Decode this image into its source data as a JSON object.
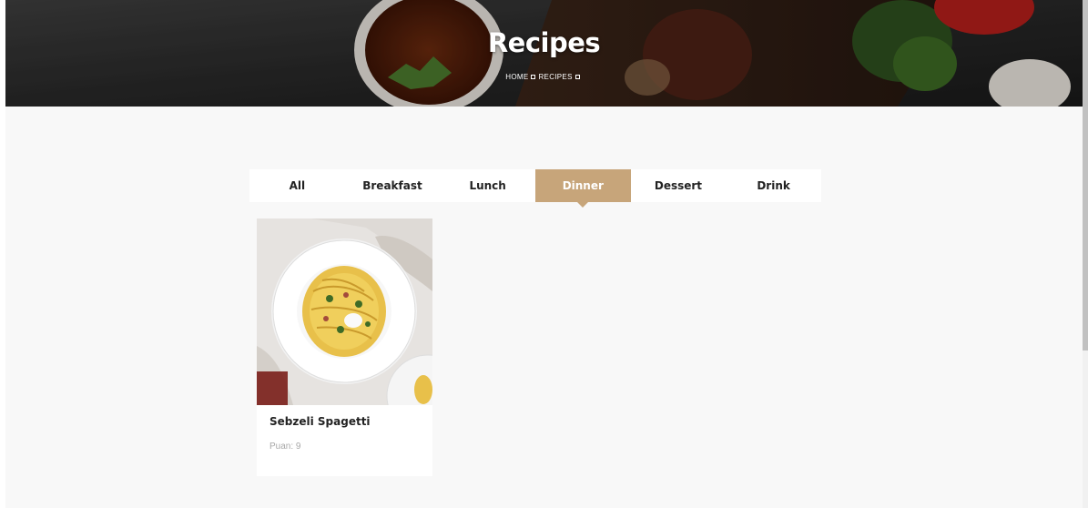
{
  "hero": {
    "title": "Recipes",
    "breadcrumb": {
      "home": "HOME",
      "current": "RECIPES"
    }
  },
  "tabs": [
    {
      "label": "All",
      "active": false
    },
    {
      "label": "Breakfast",
      "active": false
    },
    {
      "label": "Lunch",
      "active": false
    },
    {
      "label": "Dinner",
      "active": true
    },
    {
      "label": "Dessert",
      "active": false
    },
    {
      "label": "Drink",
      "active": false
    }
  ],
  "recipes": [
    {
      "title": "Sebzeli Spagetti",
      "score": "Puan: 9"
    }
  ],
  "colors": {
    "accent": "#c7a57a",
    "content_background": "#f8f8f8",
    "text_dark": "#222222",
    "text_muted": "#a8a8a8"
  }
}
